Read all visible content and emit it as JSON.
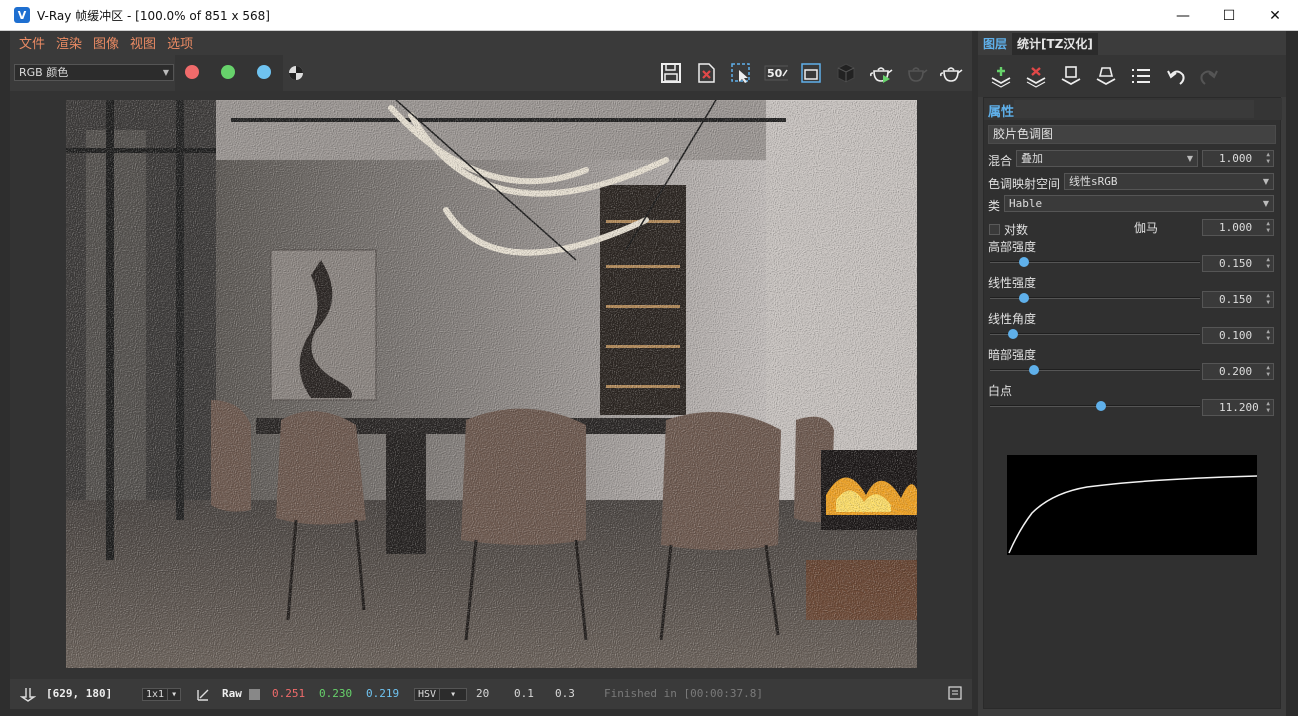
{
  "window": {
    "title": "V-Ray 帧缓冲区 - [100.0% of 851 x 568]",
    "app_icon": "V",
    "minimize_glyph": "—",
    "maximize_glyph": "☐",
    "close_glyph": "✕"
  },
  "menu": [
    "文件",
    "渲染",
    "图像",
    "视图",
    "选项"
  ],
  "toolbar": {
    "channel": "RGB 颜色",
    "dots": {
      "red": "#f06b6b",
      "green": "#67d26b",
      "blue": "#6fc3f0"
    },
    "badge_50": "50"
  },
  "status": {
    "coords": "[629, 180]",
    "zoom": "1x1",
    "raw_label": "Raw",
    "r": "0.251",
    "g": "0.230",
    "b": "0.219",
    "color_mode": "HSV",
    "h": "20",
    "s": "0.1",
    "v": "0.3",
    "finished": "Finished in [00:00:37.8]",
    "colors": {
      "r": "#f06b6b",
      "g": "#67d26b",
      "b": "#6fc3f0"
    }
  },
  "panel": {
    "tabs": [
      "图层",
      "统计[TZ汉化]"
    ],
    "props_label": "属性",
    "layer_name": "胶片色调图",
    "blend_label": "混合",
    "blend_mode": "叠加",
    "blend_value": "1.000",
    "space_label": "色调映射空间",
    "space_value": "线性sRGB",
    "type_label": "类",
    "type_value": "Hable",
    "log_label": "对数",
    "gamma_label": "伽马",
    "gamma_value": "1.000",
    "sliders": [
      {
        "label": "高部强度",
        "value": "0.150",
        "fraction": 0.16
      },
      {
        "label": "线性强度",
        "value": "0.150",
        "fraction": 0.16
      },
      {
        "label": "线性角度",
        "value": "0.100",
        "fraction": 0.11
      },
      {
        "label": "暗部强度",
        "value": "0.200",
        "fraction": 0.21
      },
      {
        "label": "白点",
        "value": "11.200",
        "fraction": 0.53
      }
    ]
  }
}
